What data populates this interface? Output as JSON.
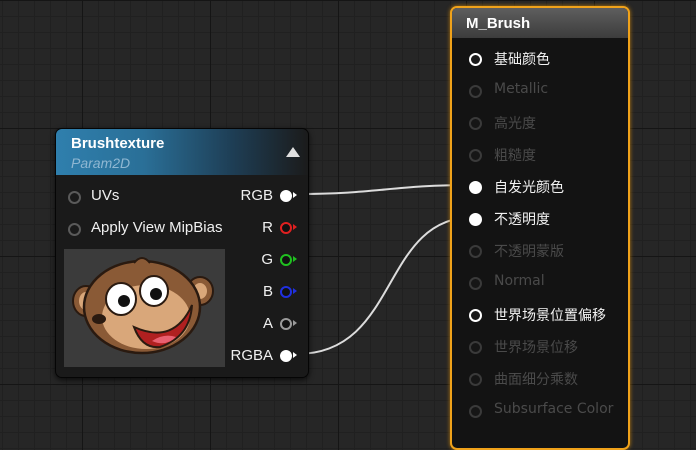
{
  "texture_node": {
    "title": "Brushtexture",
    "subtitle": "Param2D",
    "inputs": [
      {
        "label": "UVs"
      },
      {
        "label": "Apply View MipBias"
      }
    ],
    "outputs": [
      {
        "label": "RGB",
        "color": "#ffffff"
      },
      {
        "label": "R",
        "color": "#e02020"
      },
      {
        "label": "G",
        "color": "#20c020"
      },
      {
        "label": "B",
        "color": "#2030e0"
      },
      {
        "label": "A",
        "color": "#9a9a9a"
      },
      {
        "label": "RGBA",
        "color": "#ffffff"
      }
    ]
  },
  "material_node": {
    "title": "M_Brush",
    "accent_color": "#f0a21a",
    "pins": [
      {
        "label": "基础颜色",
        "active": true
      },
      {
        "label": "Metallic",
        "active": false
      },
      {
        "label": "高光度",
        "active": false
      },
      {
        "label": "粗糙度",
        "active": false
      },
      {
        "label": "自发光颜色",
        "active": true
      },
      {
        "label": "不透明度",
        "active": true
      },
      {
        "label": "不透明蒙版",
        "active": false
      },
      {
        "label": "Normal",
        "active": false
      },
      {
        "label": "世界场景位置偏移",
        "active": true
      },
      {
        "label": "世界场景位移",
        "active": false
      },
      {
        "label": "曲面细分乘数",
        "active": false
      },
      {
        "label": "Subsurface Color",
        "active": false
      }
    ]
  },
  "connections": [
    {
      "from": "RGB",
      "to": "自发光颜色"
    },
    {
      "from": "RGBA",
      "to": "不透明度"
    }
  ]
}
